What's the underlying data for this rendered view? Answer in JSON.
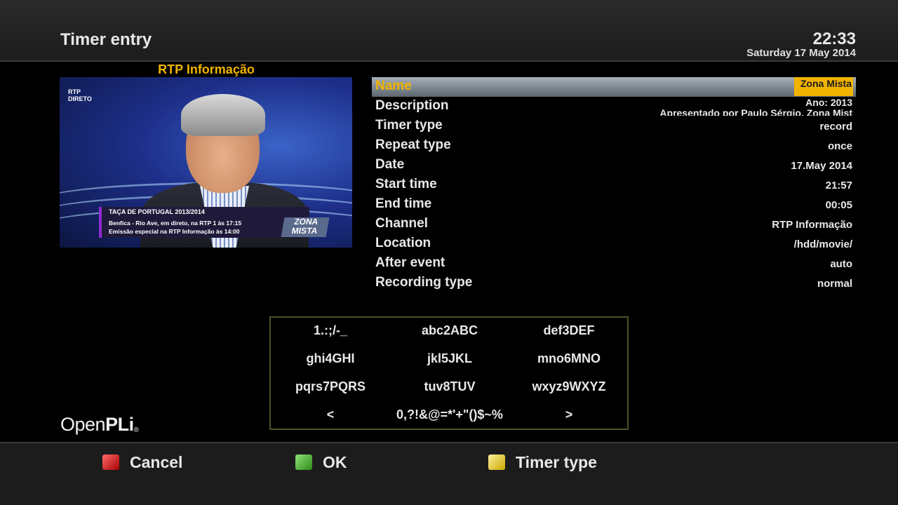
{
  "header": {
    "title": "Timer entry",
    "time": "22:33",
    "date": "Saturday 17 May 2014"
  },
  "preview": {
    "channel": "RTP Informação",
    "logo_text": "RTP",
    "logo_sub": "DIRETO",
    "ticker_title": "TAÇA DE PORTUGAL 2013/2014",
    "ticker_line1": "Benfica - Rio Ave, em direto, na RTP 1 às 17:15",
    "ticker_line2": "Emissão especial na RTP Informação às 14:00",
    "badge": "ZONA MISTA"
  },
  "settings": {
    "name": {
      "label": "Name",
      "value": "Zona Mista"
    },
    "description": {
      "label": "Description",
      "value_line1": "Ano: 2013",
      "value_line2": "Apresentado por Paulo Sérgio. Zona Mist"
    },
    "timer_type": {
      "label": "Timer type",
      "value": "record"
    },
    "repeat_type": {
      "label": "Repeat type",
      "value": "once"
    },
    "date": {
      "label": "Date",
      "value": "17.May 2014"
    },
    "start_time": {
      "label": "Start time",
      "value": "21:57"
    },
    "end_time": {
      "label": "End time",
      "value": "00:05"
    },
    "channel": {
      "label": "Channel",
      "value": "RTP Informação"
    },
    "location": {
      "label": "Location",
      "value": "/hdd/movie/"
    },
    "after_event": {
      "label": "After event",
      "value": "auto"
    },
    "recording_type": {
      "label": "Recording type",
      "value": "normal"
    }
  },
  "keypad": {
    "k1": "1.:;/-_",
    "k2": "abc2ABC",
    "k3": "def3DEF",
    "k4": "ghi4GHI",
    "k5": "jkl5JKL",
    "k6": "mno6MNO",
    "k7": "pqrs7PQRS",
    "k8": "tuv8TUV",
    "k9": "wxyz9WXYZ",
    "left": "<",
    "k0": "0,?!&@=*'+\"()$~%",
    "right": ">"
  },
  "logo": {
    "open": "Open",
    "pli": "PLi",
    "reg": "®"
  },
  "footer": {
    "red_label": "Cancel",
    "green_label": "OK",
    "yellow_label": "Timer type",
    "colors": {
      "red": "#d81e1e",
      "green": "#4cb82a",
      "yellow": "#e8cf2e",
      "accent": "#f0b400"
    }
  }
}
